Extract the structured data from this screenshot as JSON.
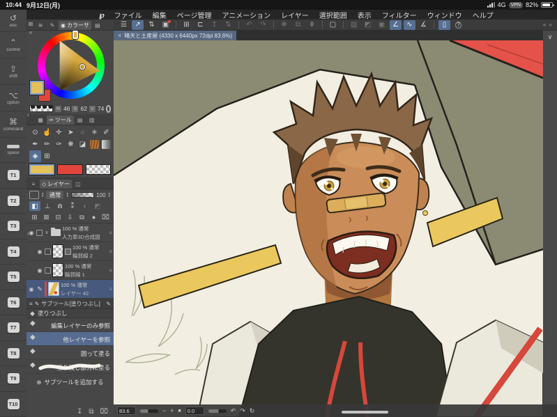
{
  "colors": {
    "accent_blue": "#566f92",
    "selection_row_blue": "#47597c",
    "main_color": "#e3c05a",
    "sub_color": "#e0463c",
    "canvas_bg": "#f2eee1",
    "canvas_olive": "#8b8a73",
    "canvas_red": "#e4524a",
    "canvas_gold": "#eac85e",
    "layer_accent_red": "#d2493e"
  },
  "status": {
    "time": "10:44",
    "date": "9月12日(月)",
    "network": "4G",
    "vpn_label": "VPN",
    "battery_percent": "82%"
  },
  "menubar": {
    "logo_glyph": "℘",
    "items": [
      "ファイル",
      "編集",
      "ページ管理",
      "アニメーション",
      "レイヤー",
      "選択範囲",
      "表示",
      "フィルター",
      "ウィンドウ",
      "ヘルプ"
    ]
  },
  "sidebar": {
    "esc_glyph": "↺",
    "esc_label": "esc",
    "modifiers": [
      {
        "glyph": "⌃",
        "label": "control"
      },
      {
        "glyph": "⇧",
        "label": "shift"
      },
      {
        "glyph": "⌥",
        "label": "option"
      },
      {
        "glyph": "⌘",
        "label": "command"
      }
    ],
    "space_label": "space",
    "tkeys": [
      "T1",
      "T2",
      "T3",
      "T4",
      "T5",
      "T6",
      "T7",
      "T8",
      "T9",
      "T10"
    ]
  },
  "toolbar": {
    "items": [
      {
        "name": "main-menu",
        "glyph": "☰"
      },
      {
        "name": "edit-in-app",
        "glyph": "↗"
      },
      {
        "name": "workspace-switch",
        "glyph": "⇅"
      },
      {
        "name": "screenshot",
        "glyph": "▣"
      },
      {
        "name": "new-canvas",
        "glyph": "⊞"
      },
      {
        "name": "open-file",
        "glyph": "⊏"
      },
      {
        "name": "save-upload",
        "glyph": "↥"
      },
      {
        "name": "save-switch",
        "glyph": "⇅"
      },
      {
        "name": "undo",
        "glyph": "↶"
      },
      {
        "name": "redo",
        "glyph": "↷"
      },
      {
        "name": "processing",
        "glyph": "❋"
      },
      {
        "name": "duplicate",
        "glyph": "⧉"
      },
      {
        "name": "clear",
        "glyph": "◊"
      },
      {
        "name": "selection",
        "glyph": "▢"
      },
      {
        "name": "deselect",
        "glyph": "▨"
      },
      {
        "name": "invert-selection",
        "glyph": "◩"
      },
      {
        "name": "expand-selection",
        "glyph": "▣"
      },
      {
        "name": "snap-to-ruler",
        "glyph": "∠"
      },
      {
        "name": "snap-to-special-ruler",
        "glyph": "∿"
      },
      {
        "name": "snap-to-grid",
        "glyph": "∡"
      },
      {
        "name": "device-display",
        "glyph": "▯"
      },
      {
        "name": "gesture-help",
        "glyph": "?"
      }
    ],
    "collapse": "« «"
  },
  "canvas": {
    "tab_close": "×",
    "tab_title": "晴天と土産屋 (4330 x 6440px 72dpi 83.6%)"
  },
  "panelstrip": {
    "close_glyph": "⊠",
    "collapse_glyph": "«",
    "handle_glyph": "‹"
  },
  "color_panel": {
    "tab_icon_1": "≋",
    "tab_icon_2": "✎",
    "active_tab_icon": "◉",
    "active_tab_label": "カラーサ",
    "extra_tab_icon": "▤",
    "hsv": {
      "h_label": "H",
      "h_value": "46",
      "s_label": "S",
      "s_value": "62",
      "v_label": "V",
      "v_value": "74"
    }
  },
  "tool_panel": {
    "material_tab_icon": "▦",
    "active_tab_icon": "✑",
    "active_tab_label": "ツール",
    "extra_tab_icon_1": "▤",
    "extra_tab_icon_2": "▥",
    "tools": [
      {
        "name": "zoom-tool",
        "glyph": "⊙"
      },
      {
        "name": "hand-tool",
        "glyph": "☝"
      },
      {
        "name": "move-tool",
        "glyph": "✛"
      },
      {
        "name": "operation-tool",
        "glyph": "➤"
      },
      {
        "name": "lasso-tool",
        "glyph": "◌"
      },
      {
        "name": "auto-select-tool",
        "glyph": "✳"
      },
      {
        "name": "eyedropper-tool",
        "glyph": "✐"
      },
      {
        "name": "pen-tool",
        "glyph": "✒"
      },
      {
        "name": "pencil-tool",
        "glyph": "✏"
      },
      {
        "name": "brush-tool",
        "glyph": "✑"
      },
      {
        "name": "airbrush-tool",
        "glyph": "❋"
      },
      {
        "name": "eraser-tool",
        "glyph": "◪"
      },
      {
        "name": "decoration-tool",
        "glyph": ""
      },
      {
        "name": "gradient-tool",
        "glyph": ""
      },
      {
        "name": "fill-tool",
        "glyph": "◈"
      },
      {
        "name": "figure-tool",
        "glyph": "⊞"
      }
    ]
  },
  "layer_panel": {
    "menu_glyph": "≡",
    "tab_icon": "◇",
    "tab_label": "レイヤー",
    "tab2_icon": "◫",
    "combine_glyph": "",
    "blend_mode": "通常",
    "opacity_value": "100",
    "locks": [
      {
        "name": "layer-select-mode",
        "glyph": "◧"
      },
      {
        "name": "clip-to-layer-below",
        "glyph": "⊥"
      },
      {
        "name": "lock-layer",
        "glyph": "⋒"
      },
      {
        "name": "lock-transparent-pixels",
        "glyph": "⁑"
      },
      {
        "name": "enable-mask",
        "glyph": "◐"
      },
      {
        "name": "ruler-setting",
        "glyph": "◩"
      }
    ],
    "actions": [
      {
        "name": "new-layer",
        "glyph": "⊞"
      },
      {
        "name": "new-layer-settings",
        "glyph": "⊠"
      },
      {
        "name": "new-folder",
        "glyph": "⊟"
      },
      {
        "name": "transfer-down",
        "glyph": "⇩"
      },
      {
        "name": "merge-down",
        "glyph": "⧉"
      },
      {
        "name": "layer-mask",
        "glyph": "●"
      },
      {
        "name": "delete-layer",
        "glyph": "⌧"
      }
    ],
    "eye_glyph": "◉",
    "pen_glyph": "✎",
    "caret_glyph": "∨",
    "handle_glyph": "≡",
    "layers": [
      {
        "pct": "100 %",
        "mode": "通常",
        "name": "人力車3D合成図"
      },
      {
        "pct": "100 %",
        "mode": "通常",
        "name": "輪郭線 2"
      },
      {
        "pct": "100 %",
        "mode": "通常",
        "name": "輪郭線 1"
      },
      {
        "pct": "100 %",
        "mode": "通常",
        "name": "レイヤー 42"
      }
    ]
  },
  "subtool_panel": {
    "menu_glyph": "≡",
    "pen_glyph": "✎",
    "tab_label": "サブツール[塗りつぶし]",
    "group_icon": "◆",
    "group_label": "塗りつぶし",
    "items": [
      {
        "label": "編集レイヤーのみ参照"
      },
      {
        "label": "他レイヤーを参照"
      },
      {
        "label": "囲って塗る"
      },
      {
        "label": "塗り残し部分に塗る"
      }
    ],
    "add_glyph": "⊕",
    "add_label": "サブツールを追加する",
    "footer": [
      {
        "name": "register-subtool",
        "glyph": "↧"
      },
      {
        "name": "duplicate-subtool",
        "glyph": "⧉"
      },
      {
        "name": "delete-subtool",
        "glyph": "⌧"
      }
    ]
  },
  "navigator": {
    "zoom_value": "83.6",
    "zoom_out": "−",
    "zoom_in": "+",
    "fit_glyph": "■",
    "rotation_value": "0.0",
    "rotate_ccw": "↶",
    "rotate_cw": "↷",
    "reset_glyph": "↻",
    "canvas_collapse_glyph": "∨"
  }
}
